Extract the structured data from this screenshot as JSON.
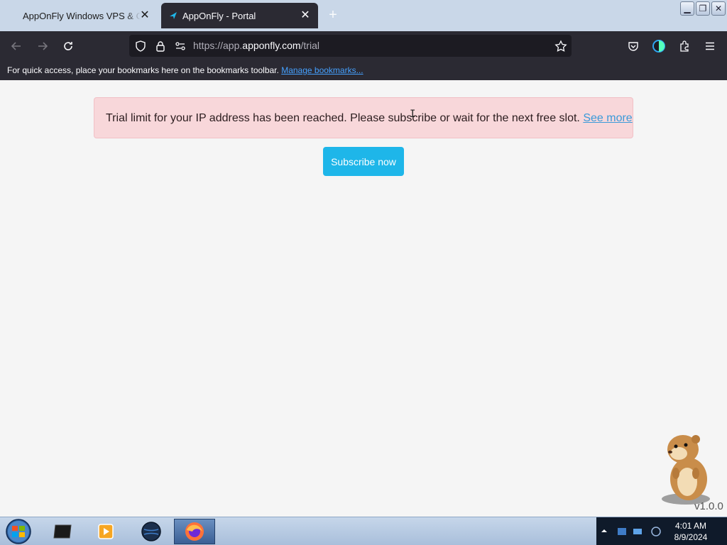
{
  "browser": {
    "tabs": [
      {
        "title": "AppOnFly Windows VPS & Clou",
        "active": false
      },
      {
        "title": "AppOnFly - Portal",
        "active": true
      }
    ],
    "url_prefix": "https://app.",
    "url_domain": "apponfly.com",
    "url_path": "/trial",
    "bookmarks_message": "For quick access, place your bookmarks here on the bookmarks toolbar.",
    "bookmarks_link": "Manage bookmarks..."
  },
  "page": {
    "alert_text": "Trial limit for your IP address has been reached. Please subscribe or wait for the next free slot.",
    "alert_link": "See more",
    "subscribe_label": "Subscribe now",
    "version": "v1.0.0"
  },
  "taskbar": {
    "time": "4:01 AM",
    "date": "8/9/2024"
  },
  "colors": {
    "alert_bg": "#f8d7da",
    "button_bg": "#1eb6e9",
    "browser_chrome": "#2b2a33"
  },
  "icons": [
    "back-icon",
    "forward-icon",
    "reload-icon",
    "shield-icon",
    "lock-icon",
    "permissions-icon",
    "star-icon",
    "pocket-icon",
    "account-icon",
    "extensions-icon",
    "menu-icon",
    "close-icon",
    "plus-icon",
    "windows-start-icon",
    "firefox-icon"
  ]
}
